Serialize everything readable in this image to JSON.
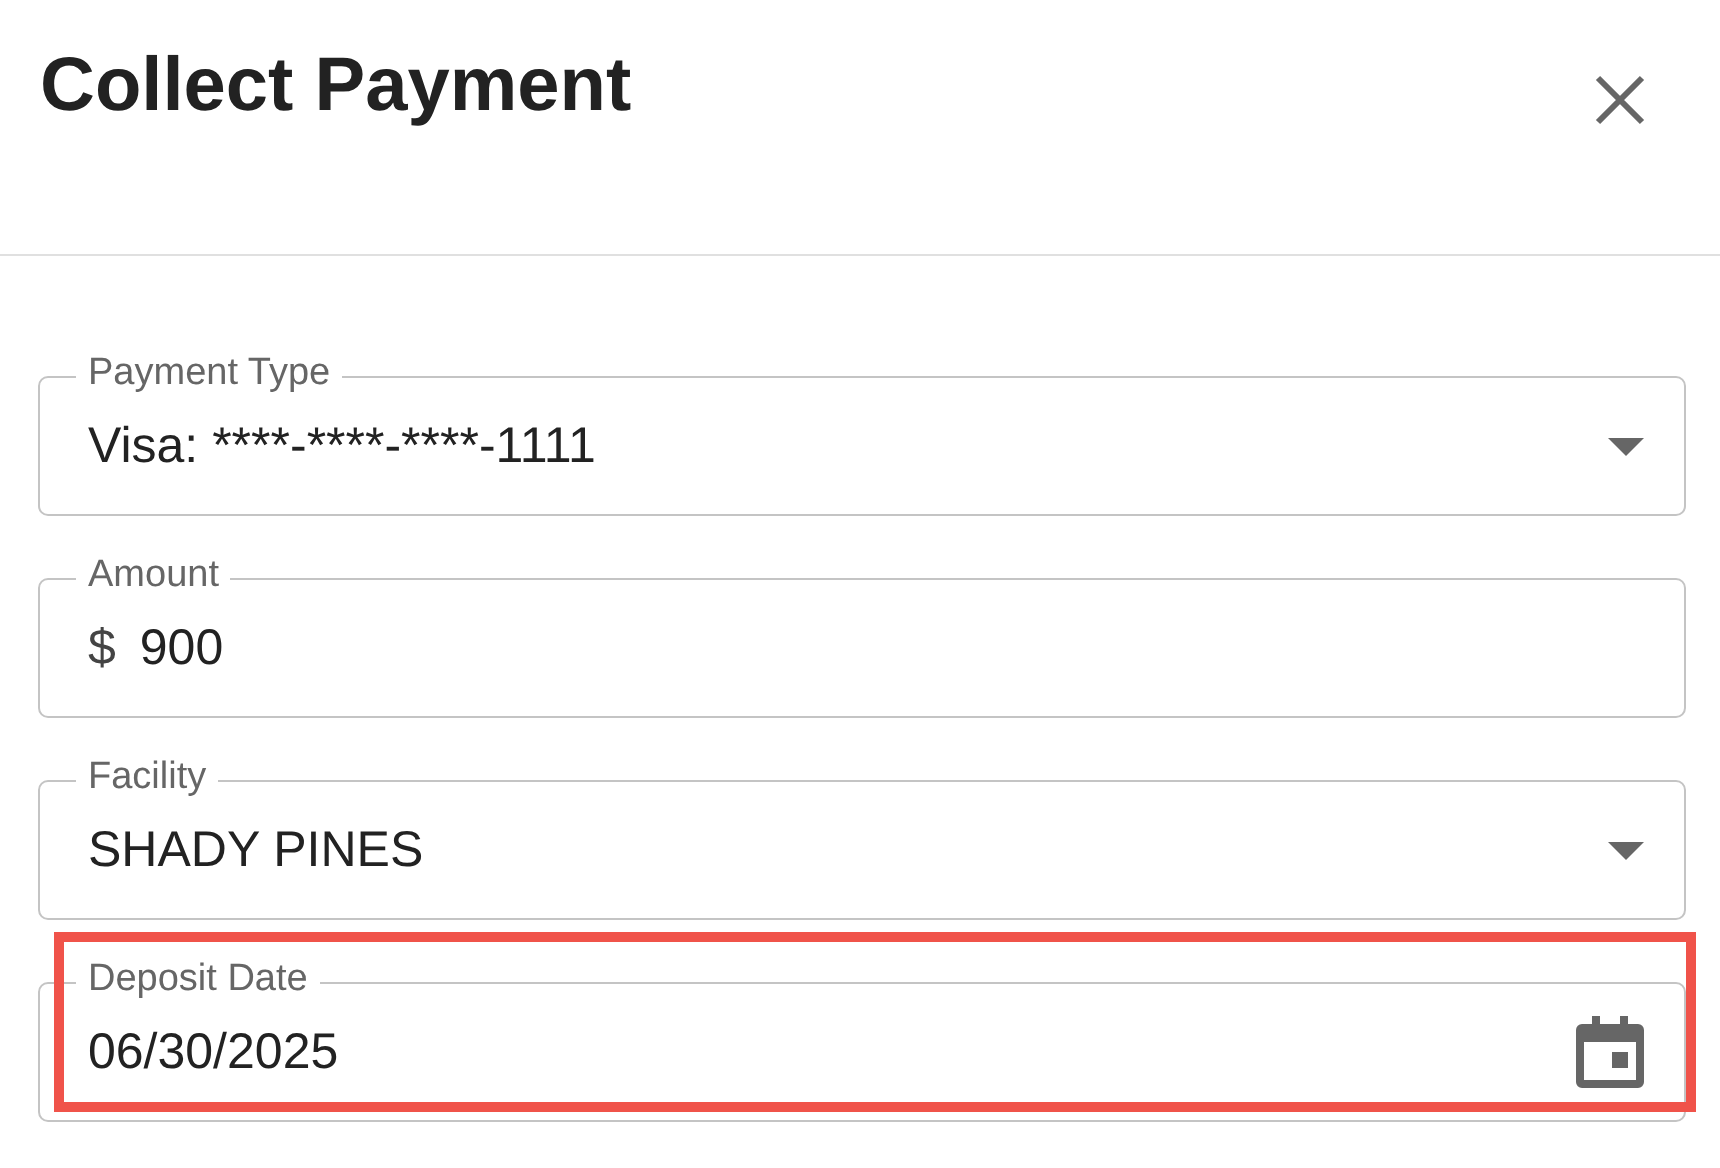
{
  "dialog": {
    "title": "Collect Payment"
  },
  "fields": [
    {
      "kind": "select",
      "label": "Payment Type",
      "value": "Visa: ****-****-****-1111",
      "highlighted": false
    },
    {
      "kind": "text",
      "label": "Amount",
      "prefix": "$",
      "value": "900",
      "highlighted": false
    },
    {
      "kind": "select",
      "label": "Facility",
      "value": "SHADY PINES",
      "highlighted": false
    },
    {
      "kind": "date",
      "label": "Deposit Date",
      "value": "06/30/2025",
      "highlighted": true
    }
  ]
}
